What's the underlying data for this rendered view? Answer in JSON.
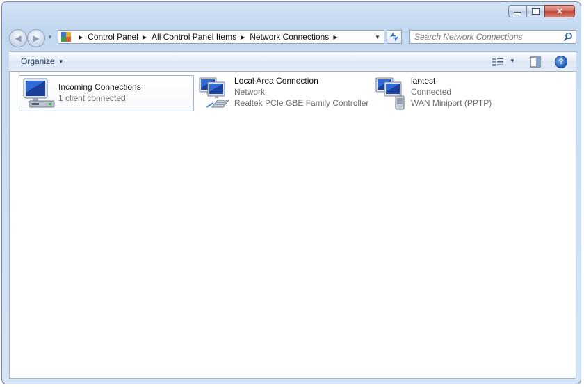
{
  "window": {
    "caption_buttons": {
      "minimize": "minimize",
      "maximize": "maximize",
      "close": "✕"
    }
  },
  "address": {
    "crumbs": [
      "Control Panel",
      "All Control Panel Items",
      "Network Connections"
    ]
  },
  "search": {
    "placeholder": "Search Network Connections"
  },
  "toolbar": {
    "organize_label": "Organize",
    "help_label": "?"
  },
  "connections": [
    {
      "name": "Incoming Connections",
      "line1": "1 client connected",
      "line2": "",
      "icon": "incoming-connection-icon",
      "selected": true
    },
    {
      "name": "Local Area Connection",
      "line1": "Network",
      "line2": "Realtek PCIe GBE Family Controller",
      "icon": "lan-connection-icon",
      "selected": false
    },
    {
      "name": "lantest",
      "line1": "Connected",
      "line2": "WAN Miniport (PPTP)",
      "icon": "vpn-connection-icon",
      "selected": false
    }
  ],
  "colors": {
    "accent": "#2c6bb8",
    "window_frame": "#c2d7ef",
    "close_button": "#c24434"
  }
}
